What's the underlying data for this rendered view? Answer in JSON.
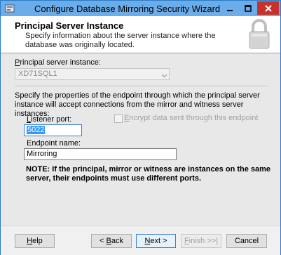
{
  "window": {
    "title": "Configure Database Mirroring Security Wizard",
    "controls": {
      "minimize": "minimize",
      "maximize": "maximize",
      "close": "close"
    }
  },
  "header": {
    "title": "Principal Server Instance",
    "description": "Specify information about the server instance where the database was originally located."
  },
  "principal": {
    "label_first": "P",
    "label_rest": "rincipal server instance:",
    "value": "XD71SQL1"
  },
  "endpoint_desc": "Specify the properties of the endpoint through which the principal server instance will accept connections from the mirror and witness server instances:",
  "listener_port": {
    "label_first": "L",
    "label_rest": "istener port:",
    "value": "5022"
  },
  "encrypt": {
    "label_first": "E",
    "label_rest": "ncrypt data sent through this endpoint",
    "checked": false
  },
  "endpoint_name": {
    "label": "Endpoint name:",
    "value": "Mirroring"
  },
  "note": "NOTE: If the principal, mirror or witness are instances on the same server, their endpoints must use different ports.",
  "buttons": {
    "help": {
      "u": "H",
      "rest": "elp"
    },
    "back": {
      "prefix": "< ",
      "u": "B",
      "rest": "ack"
    },
    "next": {
      "u": "N",
      "rest": "ext >"
    },
    "finish": {
      "u": "F",
      "rest": "inish >>|"
    },
    "cancel": "Cancel"
  },
  "colors": {
    "titlebar": "#6badea",
    "close_button": "#c7312b",
    "selection": "#3399ff"
  },
  "icons": {
    "app": "wizard-app-icon",
    "lock": "padlock-icon",
    "combo": "chevron-down-icon"
  }
}
